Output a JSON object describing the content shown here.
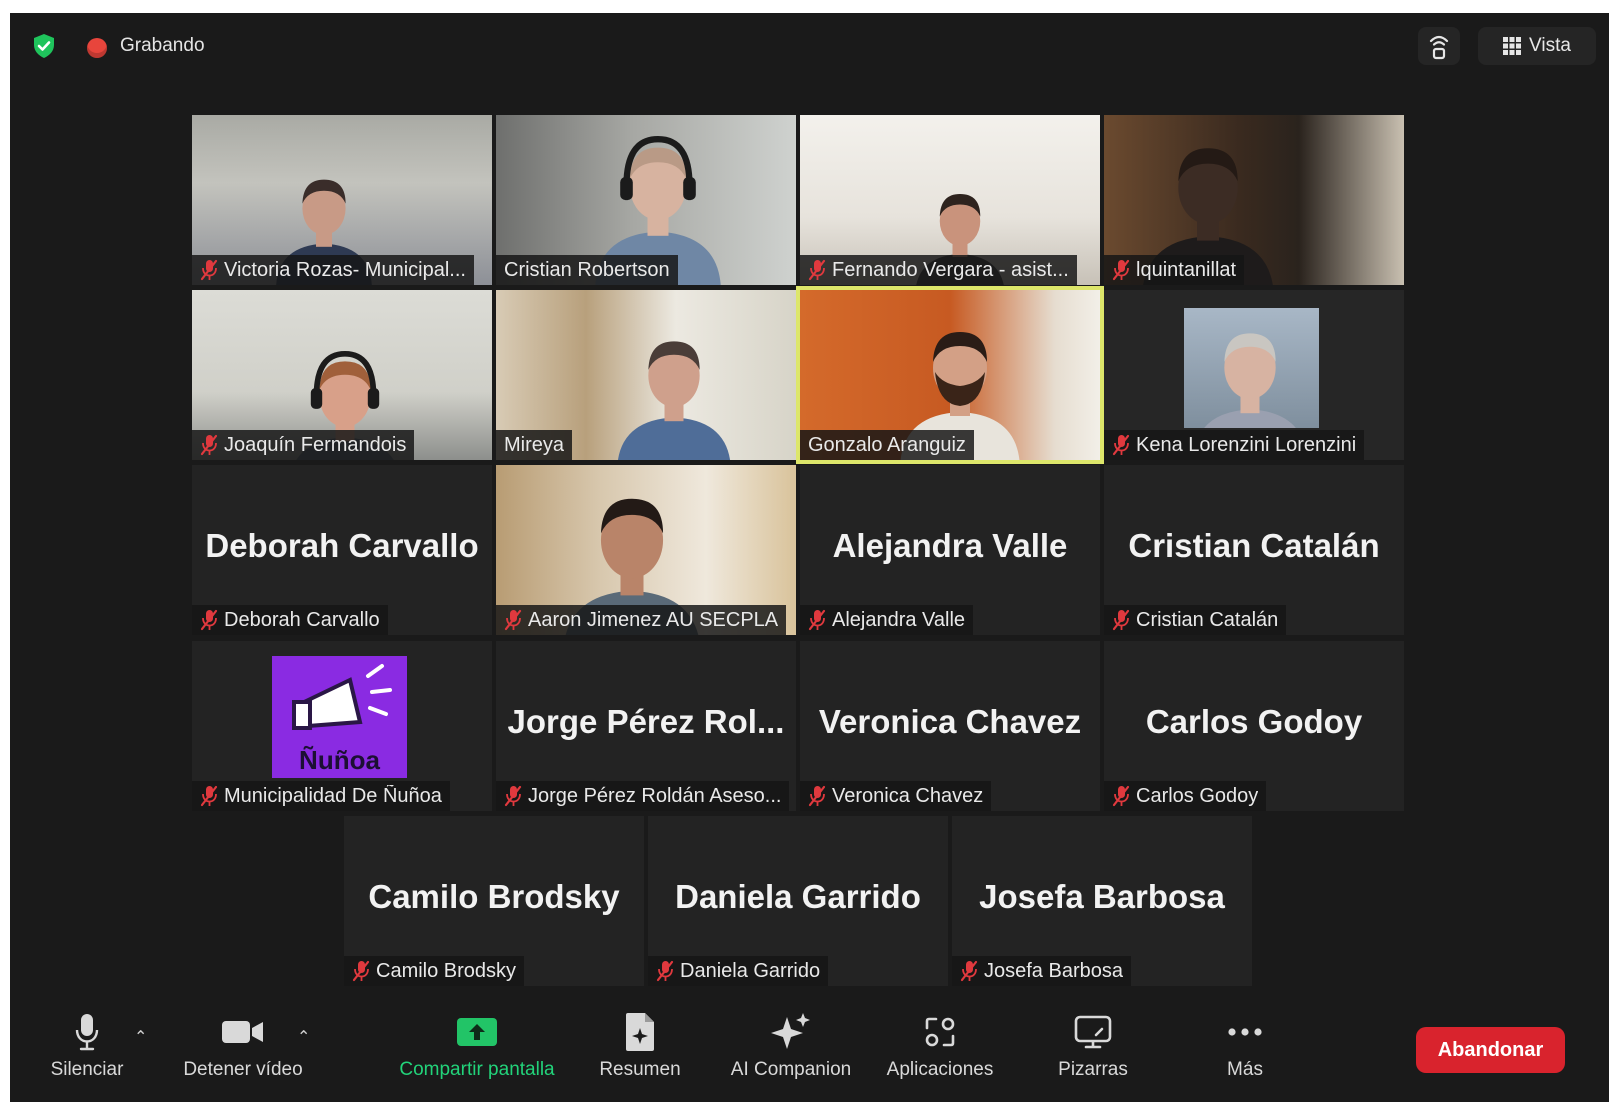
{
  "topbar": {
    "recording_label": "Grabando",
    "view_label": "Vista"
  },
  "participants": [
    {
      "name": "Victoria Rozas- Municipal...",
      "muted": true,
      "video": true,
      "scene": "victoria"
    },
    {
      "name": "Cristian Robertson",
      "muted": false,
      "video": true,
      "scene": "cristianr"
    },
    {
      "name": "Fernando Vergara - asist...",
      "muted": true,
      "video": true,
      "scene": "fernando"
    },
    {
      "name": "lquintanillat",
      "muted": true,
      "video": true,
      "scene": "lquintanillat"
    },
    {
      "name": "Joaquín Fermandois",
      "muted": true,
      "video": true,
      "scene": "joaquin"
    },
    {
      "name": "Mireya",
      "muted": false,
      "video": true,
      "scene": "mireya"
    },
    {
      "name": "Gonzalo Aranguiz",
      "muted": false,
      "video": true,
      "active_speaker": true,
      "scene": "gonzalo"
    },
    {
      "name": "Kena Lorenzini Lorenzini",
      "muted": true,
      "video": true,
      "scene": "kena"
    },
    {
      "name": "Deborah Carvallo",
      "display_name": "Deborah Carvallo",
      "muted": true,
      "video": false
    },
    {
      "name": "Aaron Jimenez AU SECPLA",
      "muted": true,
      "video": true,
      "scene": "aaron"
    },
    {
      "name": "Alejandra Valle",
      "display_name": "Alejandra Valle",
      "muted": true,
      "video": false
    },
    {
      "name": "Cristian Catalán",
      "display_name": "Cristian Catalán",
      "muted": true,
      "video": false
    },
    {
      "name": "Municipalidad De Ñuñoa",
      "muted": true,
      "video": false,
      "avatar_logo": true,
      "logo_text": "Ñuñoa"
    },
    {
      "name": "Jorge Pérez Roldán Aseso...",
      "display_name": "Jorge  Pérez  Rol...",
      "muted": true,
      "video": false
    },
    {
      "name": "Veronica Chavez",
      "display_name": "Veronica Chavez",
      "muted": true,
      "video": false
    },
    {
      "name": "Carlos Godoy",
      "display_name": "Carlos Godoy",
      "muted": true,
      "video": false
    },
    {
      "name": "Camilo Brodsky",
      "display_name": "Camilo Brodsky",
      "muted": true,
      "video": false
    },
    {
      "name": "Daniela Garrido",
      "display_name": "Daniela Garrido",
      "muted": true,
      "video": false
    },
    {
      "name": "Josefa Barbosa",
      "display_name": "Josefa Barbosa",
      "muted": true,
      "video": false
    }
  ],
  "toolbar": {
    "mute_label": "Silenciar",
    "video_label": "Detener vídeo",
    "share_label": "Compartir pantalla",
    "summary_label": "Resumen",
    "ai_label": "AI Companion",
    "apps_label": "Aplicaciones",
    "whiteboards_label": "Pizarras",
    "more_label": "Más",
    "leave_label": "Abandonar"
  },
  "colors": {
    "background": "#1a1a1a",
    "tile": "#232323",
    "active_speaker": "#dde66a",
    "share_green": "#22d37a",
    "leave_red": "#d9232d",
    "muted_red": "#e0393e",
    "logo_purple": "#8a2be2"
  }
}
